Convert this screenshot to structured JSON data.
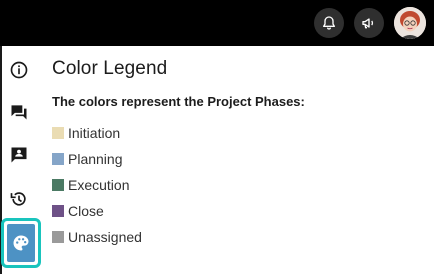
{
  "header": {
    "notifications_icon": "bell-icon",
    "announcements_icon": "megaphone-icon",
    "avatar_icon": "user-avatar"
  },
  "sidebar": {
    "items": [
      {
        "icon": "info-icon"
      },
      {
        "icon": "chat-icon"
      },
      {
        "icon": "contact-card-icon"
      },
      {
        "icon": "history-icon"
      },
      {
        "icon": "palette-icon",
        "active": true
      }
    ],
    "active_color": "#19c4bd",
    "active_fill": "#4d92c4"
  },
  "legend": {
    "title": "Color Legend",
    "subtitle": "The colors represent the Project Phases:",
    "items": [
      {
        "label": "Initiation",
        "color": "#eadcb3"
      },
      {
        "label": "Planning",
        "color": "#85a5c8"
      },
      {
        "label": "Execution",
        "color": "#4b7a64"
      },
      {
        "label": "Close",
        "color": "#6e5187"
      },
      {
        "label": "Unassigned",
        "color": "#9a9a9a"
      }
    ]
  }
}
